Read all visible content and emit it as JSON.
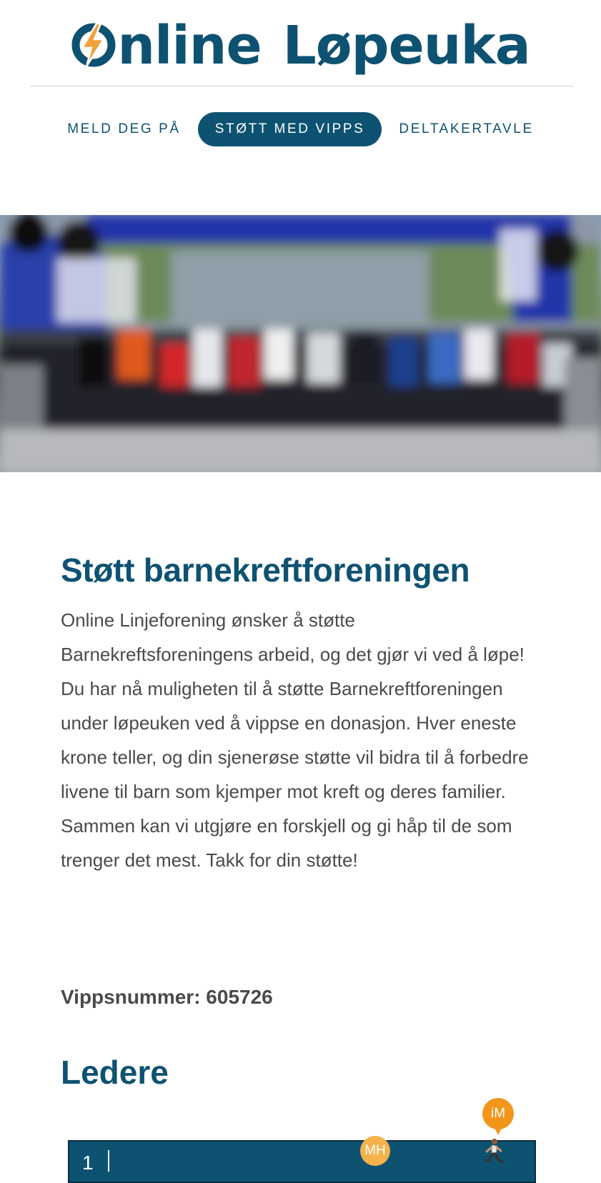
{
  "logo": {
    "word1": "nline",
    "word2": "Løpeuka",
    "icon": "lightning-o-icon",
    "colors": {
      "brand": "#0e5272",
      "accent": "#f1a23a"
    }
  },
  "nav": {
    "items": [
      {
        "label": "MELD DEG PÅ",
        "active": false
      },
      {
        "label": "STØTT MED VIPPS",
        "active": true
      },
      {
        "label": "DELTAKERTAVLE",
        "active": false
      }
    ]
  },
  "hero": {
    "description_icon": "race-start-photo"
  },
  "support": {
    "heading": "Støtt barnekreftforeningen",
    "body": "Online Linjeforening ønsker å støtte Barnekreftsforeningens arbeid, og det gjør vi ved å løpe! Du har nå muligheten til å støtte Barnekreftforeningen under løpeuken ved å vippse en donasjon. Hver eneste krone teller, og din sjenerøse støtte vil bidra til å forbedre livene til barn som kjemper mot kreft og deres familier. Sammen kan vi utgjøre en forskjell og gi håp til de som trenger det mest. Takk for din støtte!",
    "vipps": "Vippsnummer: 605726"
  },
  "leaders": {
    "heading": "Ledere",
    "rows": [
      {
        "rank": "1",
        "markers": [
          "MH",
          "iM"
        ]
      }
    ]
  }
}
